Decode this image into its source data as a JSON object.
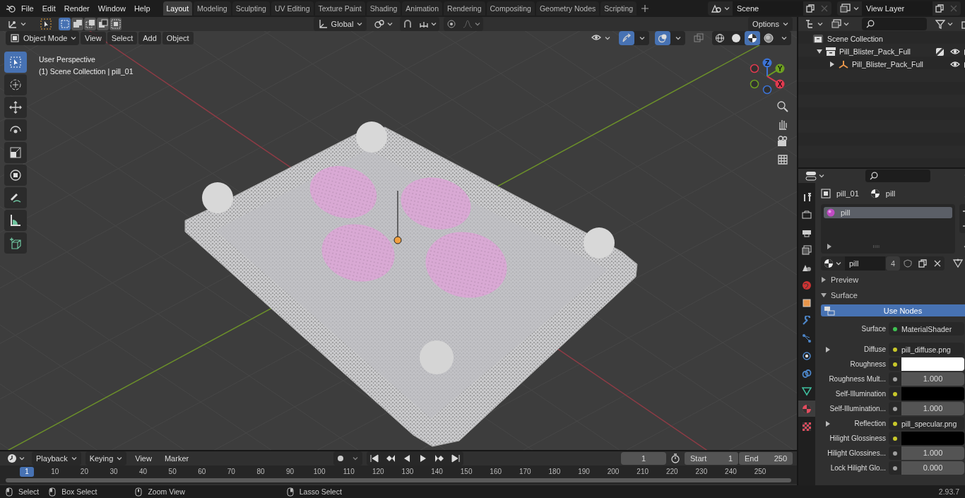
{
  "menu": [
    "File",
    "Edit",
    "Render",
    "Window",
    "Help"
  ],
  "workspaces": [
    {
      "label": "Layout",
      "selected": true
    },
    {
      "label": "Modeling",
      "selected": false
    },
    {
      "label": "Sculpting",
      "selected": false
    },
    {
      "label": "UV Editing",
      "selected": false
    },
    {
      "label": "Texture Paint",
      "selected": false
    },
    {
      "label": "Shading",
      "selected": false
    },
    {
      "label": "Animation",
      "selected": false
    },
    {
      "label": "Rendering",
      "selected": false
    },
    {
      "label": "Compositing",
      "selected": false
    },
    {
      "label": "Geometry Nodes",
      "selected": false
    },
    {
      "label": "Scripting",
      "selected": false
    }
  ],
  "scene": "Scene",
  "view_layer": "View Layer",
  "tool_header": {
    "select_modes": [
      {
        "kind": "set",
        "selected": true
      },
      {
        "kind": "extend",
        "selected": false
      },
      {
        "kind": "subtract",
        "selected": false
      },
      {
        "kind": "difference",
        "selected": false
      },
      {
        "kind": "intersect",
        "selected": false
      }
    ],
    "orientation": "Global",
    "options": "Options"
  },
  "viewport_header": {
    "mode": "Object Mode",
    "menus": [
      "View",
      "Select",
      "Add",
      "Object"
    ],
    "gizmos_on": true,
    "overlays_on": true,
    "xray_on": false,
    "shading": [
      {
        "kind": "wireframe",
        "selected": false
      },
      {
        "kind": "solid",
        "selected": false
      },
      {
        "kind": "material",
        "selected": true
      },
      {
        "kind": "rendered",
        "selected": false
      }
    ]
  },
  "viewport": {
    "info": [
      "User Perspective",
      "(1) Scene Collection | pill_01"
    ],
    "tools": [
      {
        "kind": "select-box",
        "selected": true
      },
      {
        "kind": "cursor",
        "selected": false
      },
      {
        "kind": "move",
        "selected": false
      },
      {
        "kind": "rotate",
        "selected": false
      },
      {
        "kind": "scale",
        "selected": false
      },
      {
        "kind": "transform",
        "selected": false
      },
      {
        "kind": "annotate",
        "selected": false
      },
      {
        "kind": "measure",
        "selected": false
      },
      {
        "kind": "add-cube",
        "selected": false
      }
    ],
    "gizmo": [
      {
        "label": "Z",
        "color": "#3d74d6"
      },
      {
        "label": "Y",
        "color": "#6ea021"
      },
      {
        "label": "X",
        "color": "#e33a50"
      }
    ]
  },
  "outliner": {
    "root": "Scene Collection",
    "items": [
      {
        "label": "Pill_Blister_Pack_Full",
        "kind": "collection",
        "expanded": true,
        "checked": true,
        "children": [
          {
            "label": "Pill_Blister_Pack_Full",
            "kind": "empty",
            "expanded": false
          }
        ]
      }
    ]
  },
  "properties": {
    "tabs": [
      {
        "kind": "tool",
        "selected": false
      },
      {
        "kind": "render",
        "selected": false
      },
      {
        "kind": "output",
        "selected": false
      },
      {
        "kind": "view-layer",
        "selected": false
      },
      {
        "kind": "scene",
        "selected": false
      },
      {
        "kind": "world",
        "selected": false
      },
      {
        "kind": "object",
        "selected": false
      },
      {
        "kind": "modifier",
        "selected": false
      },
      {
        "kind": "particles",
        "selected": false
      },
      {
        "kind": "physics",
        "selected": false
      },
      {
        "kind": "constraint",
        "selected": false
      },
      {
        "kind": "data",
        "selected": false
      },
      {
        "kind": "material",
        "selected": true
      },
      {
        "kind": "texture",
        "selected": false
      }
    ],
    "object": "pill_01",
    "material": "pill",
    "slots": [
      {
        "label": "pill",
        "selected": true
      }
    ],
    "material_name": "pill",
    "users": "4",
    "panels": [
      {
        "label": "Preview",
        "expanded": false
      },
      {
        "label": "Surface",
        "expanded": true
      }
    ],
    "use_nodes": "Use Nodes",
    "rows": [
      {
        "kind": "shader",
        "label": "Surface",
        "value": "MaterialShader",
        "expandable": false
      },
      {
        "kind": "link",
        "label": "Diffuse",
        "value": "pill_diffuse.png",
        "expandable": true
      },
      {
        "kind": "swatch",
        "label": "Roughness",
        "color": "#ffffff",
        "expandable": false
      },
      {
        "kind": "number",
        "label": "Roughness Mult...",
        "value": "1.000",
        "expandable": false
      },
      {
        "kind": "swatch",
        "label": "Self-Illumination",
        "color": "#000000",
        "expandable": false
      },
      {
        "kind": "number",
        "label": "Self-Illumination...",
        "value": "1.000",
        "expandable": false
      },
      {
        "kind": "link",
        "label": "Reflection",
        "value": "pill_specular.png",
        "expandable": true
      },
      {
        "kind": "swatch",
        "label": "Hilight Glossiness",
        "color": "#000000",
        "expandable": false
      },
      {
        "kind": "number",
        "label": "Hilight Glossines...",
        "value": "1.000",
        "expandable": false
      },
      {
        "kind": "number",
        "label": "Lock Hilight Glo...",
        "value": "0.000",
        "expandable": false
      }
    ]
  },
  "timeline": {
    "menus": [
      {
        "label": "Playback",
        "dropdown": true
      },
      {
        "label": "Keying",
        "dropdown": true
      },
      {
        "label": "View",
        "dropdown": false
      },
      {
        "label": "Marker",
        "dropdown": false
      }
    ],
    "current_frame": "1",
    "start_label": "Start",
    "start": "1",
    "end_label": "End",
    "end": "250",
    "ruler": [
      {
        "label": "1",
        "selected": true
      },
      {
        "label": "10",
        "selected": false
      },
      {
        "label": "20",
        "selected": false
      },
      {
        "label": "30",
        "selected": false
      },
      {
        "label": "40",
        "selected": false
      },
      {
        "label": "50",
        "selected": false
      },
      {
        "label": "60",
        "selected": false
      },
      {
        "label": "70",
        "selected": false
      },
      {
        "label": "80",
        "selected": false
      },
      {
        "label": "90",
        "selected": false
      },
      {
        "label": "100",
        "selected": false
      },
      {
        "label": "110",
        "selected": false
      },
      {
        "label": "120",
        "selected": false
      },
      {
        "label": "130",
        "selected": false
      },
      {
        "label": "140",
        "selected": false
      },
      {
        "label": "150",
        "selected": false
      },
      {
        "label": "160",
        "selected": false
      },
      {
        "label": "170",
        "selected": false
      },
      {
        "label": "180",
        "selected": false
      },
      {
        "label": "190",
        "selected": false
      },
      {
        "label": "200",
        "selected": false
      },
      {
        "label": "210",
        "selected": false
      },
      {
        "label": "220",
        "selected": false
      },
      {
        "label": "230",
        "selected": false
      },
      {
        "label": "240",
        "selected": false
      },
      {
        "label": "250",
        "selected": false
      }
    ]
  },
  "status_bar": {
    "hints": [
      {
        "kind": "left",
        "label": "Select"
      },
      {
        "kind": "left",
        "label": "Box Select"
      },
      {
        "kind": "middle",
        "label": "Zoom View"
      },
      {
        "kind": "right",
        "label": "Lasso Select"
      }
    ],
    "version": "2.93.7"
  }
}
